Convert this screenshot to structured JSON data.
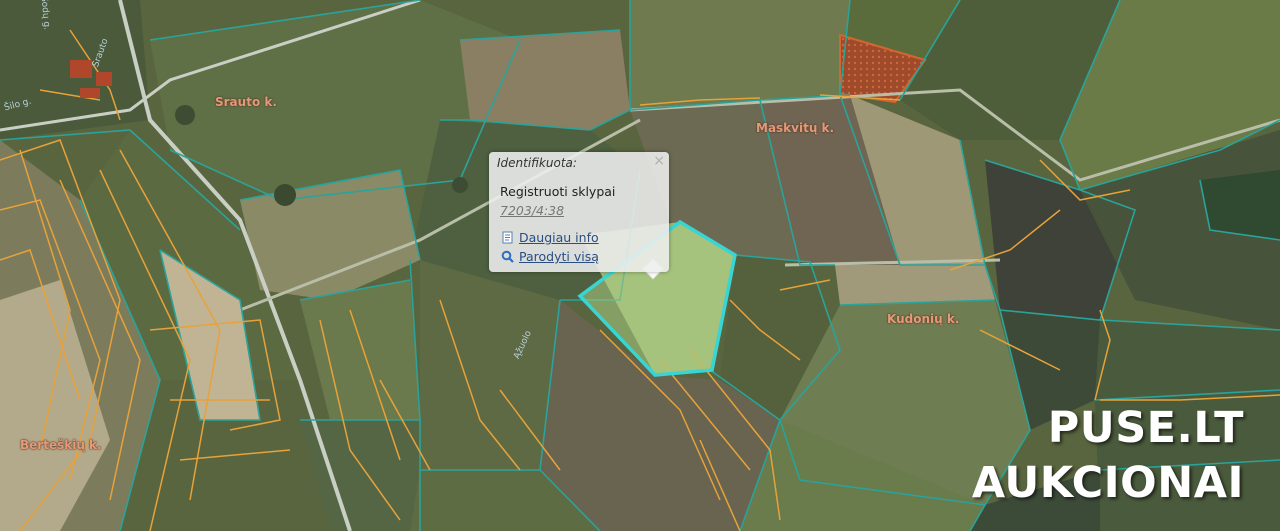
{
  "places": [
    "Srauto k.",
    "Maskvitų k.",
    "Kudonių k.",
    "Berteškių k."
  ],
  "road_labels": [
    "Sodų g.",
    "Srauto",
    "Šilo g.",
    "Ąžuolo"
  ],
  "popup": {
    "heading": "Identifikuota:",
    "close_symbol": "×",
    "layer_name": "Registruoti sklypai",
    "parcel_id": "7203/4:38",
    "more_info_label": "Daugiau info",
    "show_all_label": "Parodyti visą"
  },
  "watermark": {
    "line1": "PUSE.LT",
    "line2": "AUKCIONAI"
  },
  "colors": {
    "parcel_border": "#2aa39a",
    "cadastral_border": "#e7a23a",
    "selected_parcel": "#37d6d4",
    "place_label": "#e49a79",
    "link": "#2a4d83",
    "hatched_area": "#d5652e"
  }
}
